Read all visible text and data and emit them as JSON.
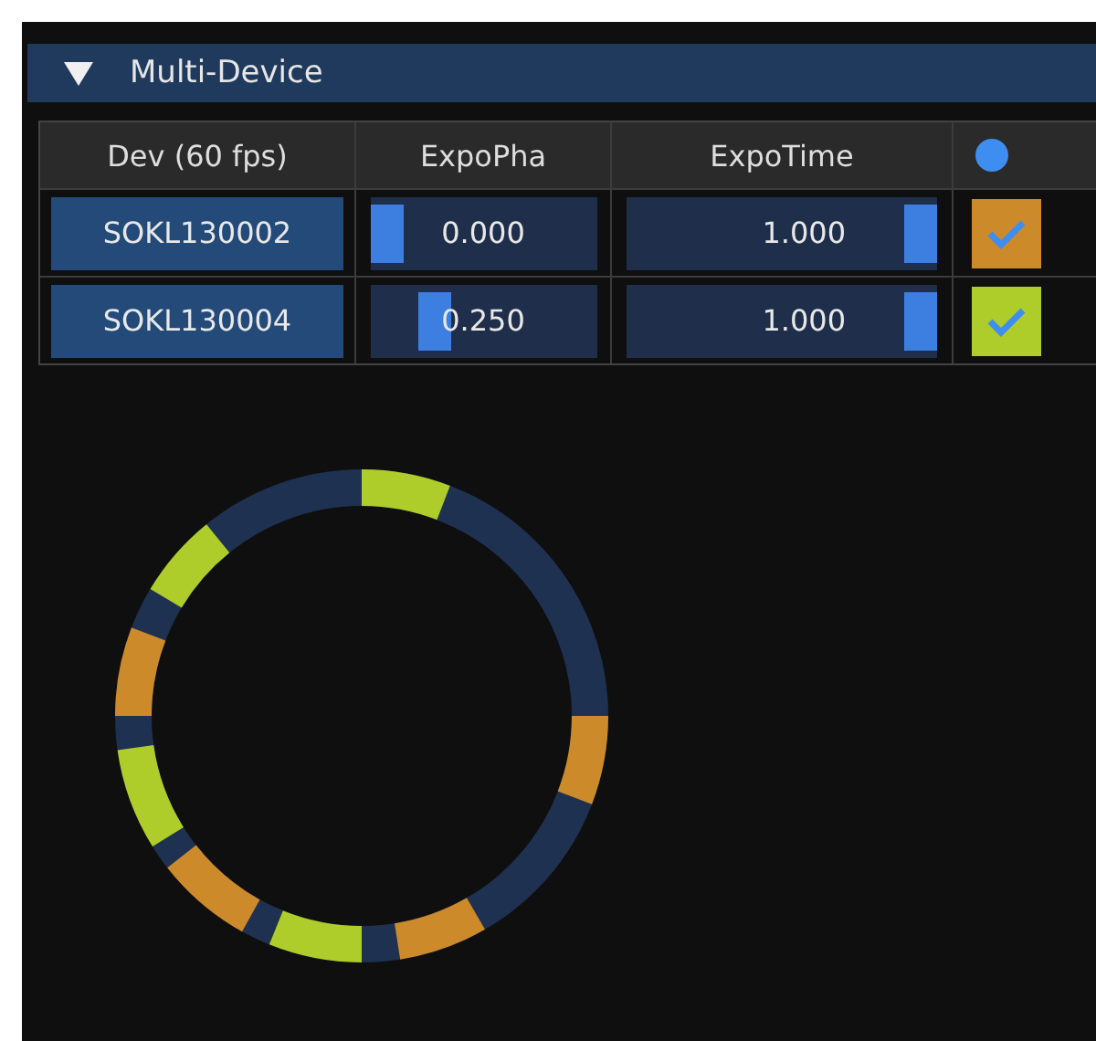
{
  "panel": {
    "title": "Multi-Device",
    "expanded": true
  },
  "table": {
    "columns": [
      "Dev (60 fps)",
      "ExpoPha",
      "ExpoTime"
    ],
    "rows": [
      {
        "device": "SOKL130002",
        "expo_pha": {
          "value": "0.000",
          "level": 0
        },
        "expo_time": {
          "value": "1.000",
          "level": 1
        },
        "checked": true,
        "color": "#cc8a2a"
      },
      {
        "device": "SOKL130004",
        "expo_pha": {
          "value": "0.250",
          "level": 0.25
        },
        "expo_time": {
          "value": "1.000",
          "level": 1
        },
        "checked": true,
        "color": "#aecc2a"
      }
    ]
  }
}
